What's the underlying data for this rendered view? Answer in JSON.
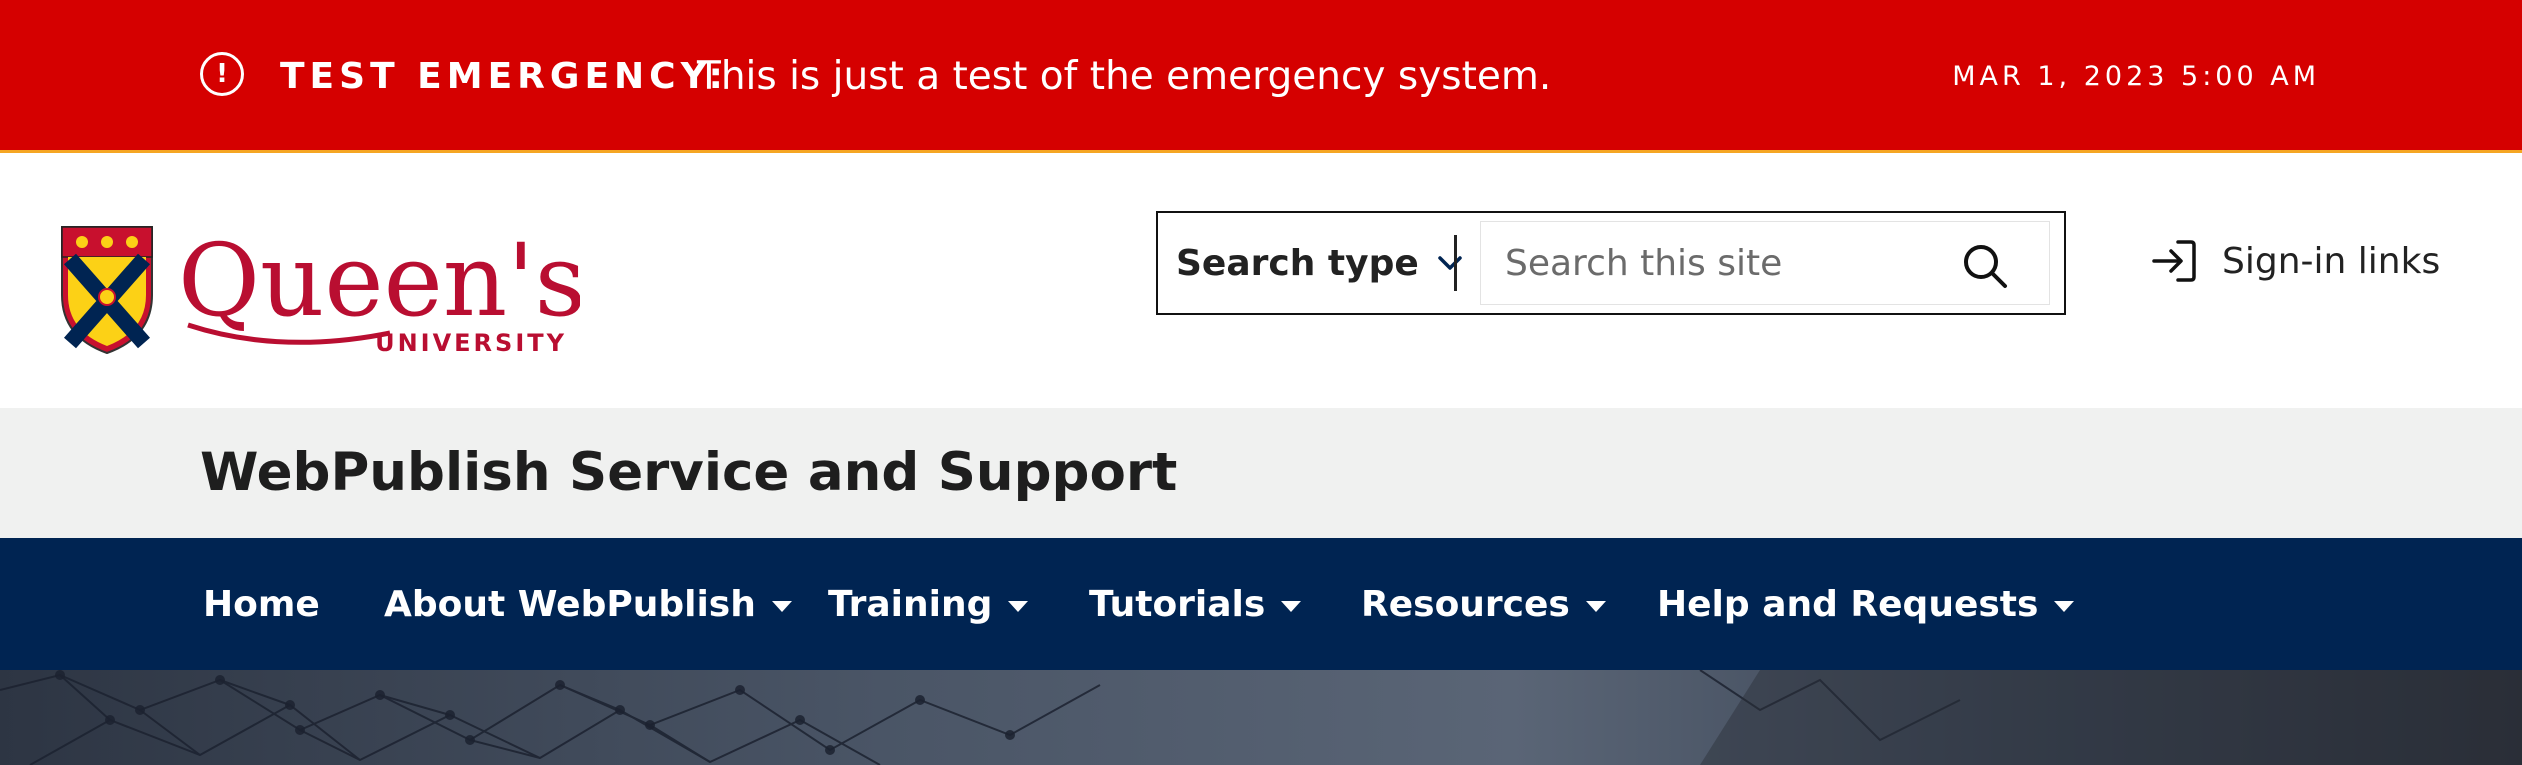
{
  "alert": {
    "icon": "exclamation-circle-icon",
    "label": "TEST EMERGENCY:",
    "message": "This is just a test of the emergency system.",
    "date": "MAR 1, 2023 5:00 AM",
    "colors": {
      "background": "#d50000",
      "accent": "#f5a623"
    }
  },
  "header": {
    "logo": {
      "wordmark": "Queen's",
      "subtitle": "UNIVERSITY",
      "crest": "queens-crest-icon"
    },
    "search": {
      "type_label": "Search type",
      "placeholder": "Search this site",
      "value": "",
      "icon": "search-icon"
    },
    "signin": {
      "label": "Sign-in links",
      "icon": "sign-in-icon"
    }
  },
  "site_title": "WebPublish Service and Support",
  "nav": {
    "items": [
      {
        "label": "Home",
        "dropdown": false
      },
      {
        "label": "About WebPublish",
        "dropdown": true
      },
      {
        "label": "Training",
        "dropdown": true
      },
      {
        "label": "Tutorials",
        "dropdown": true
      },
      {
        "label": "Resources",
        "dropdown": true
      },
      {
        "label": "Help and Requests",
        "dropdown": true
      }
    ],
    "colors": {
      "background": "#002452"
    }
  }
}
